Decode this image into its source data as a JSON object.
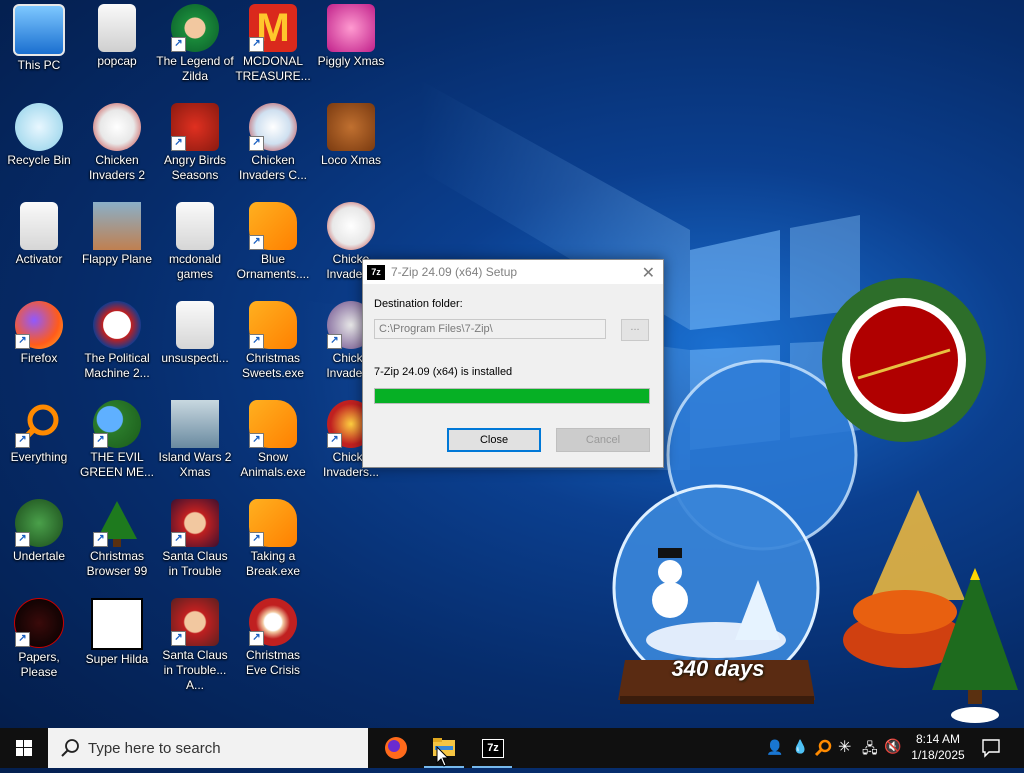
{
  "desktop": {
    "icons": [
      {
        "label": "This PC"
      },
      {
        "label": "popcap"
      },
      {
        "label": "The Legend of Zilda"
      },
      {
        "label": "MCDONAL TREASURE..."
      },
      {
        "label": "Piggly Xmas"
      },
      {
        "label": "Recycle Bin"
      },
      {
        "label": "Chicken Invaders 2"
      },
      {
        "label": "Angry Birds Seasons"
      },
      {
        "label": "Chicken Invaders C..."
      },
      {
        "label": "Loco Xmas"
      },
      {
        "label": "Activator"
      },
      {
        "label": "Flappy Plane"
      },
      {
        "label": "mcdonald games"
      },
      {
        "label": "Blue Ornaments...."
      },
      {
        "label": "Chicke Invader..."
      },
      {
        "label": "Firefox"
      },
      {
        "label": "The Political Machine 2..."
      },
      {
        "label": "unsuspecti..."
      },
      {
        "label": "Christmas Sweets.exe"
      },
      {
        "label": "Chicke Invader..."
      },
      {
        "label": "Everything"
      },
      {
        "label": "THE EVIL GREEN ME..."
      },
      {
        "label": "Island Wars 2 Xmas"
      },
      {
        "label": "Snow Animals.exe"
      },
      {
        "label": "Chicke Invaders..."
      },
      {
        "label": "Undertale"
      },
      {
        "label": "Christmas Browser 99"
      },
      {
        "label": "Santa Claus in Trouble"
      },
      {
        "label": "Taking a Break.exe"
      },
      {
        "label": "Papers, Please"
      },
      {
        "label": "Super Hilda"
      },
      {
        "label": "Santa Claus in Trouble... A..."
      },
      {
        "label": "Christmas Eve Crisis"
      }
    ],
    "wallpaper": {
      "countdown": "340 days"
    }
  },
  "dialog": {
    "title": "7-Zip 24.09 (x64) Setup",
    "app_icon": "7z",
    "destination_label": "Destination folder:",
    "destination_value": "C:\\Program Files\\7-Zip\\",
    "browse_label": "...",
    "status": "7-Zip 24.09 (x64) is installed",
    "progress_percent": 100,
    "close_label": "Close",
    "cancel_label": "Cancel",
    "progress_color": "#06b025"
  },
  "taskbar": {
    "search_placeholder": "Type here to search",
    "pinned": [
      {
        "name": "firefox-icon"
      },
      {
        "name": "file-explorer-icon"
      },
      {
        "name": "7zip-icon",
        "text": "7z"
      }
    ],
    "clock_time": "8:14 AM",
    "clock_date": "1/18/2025"
  }
}
